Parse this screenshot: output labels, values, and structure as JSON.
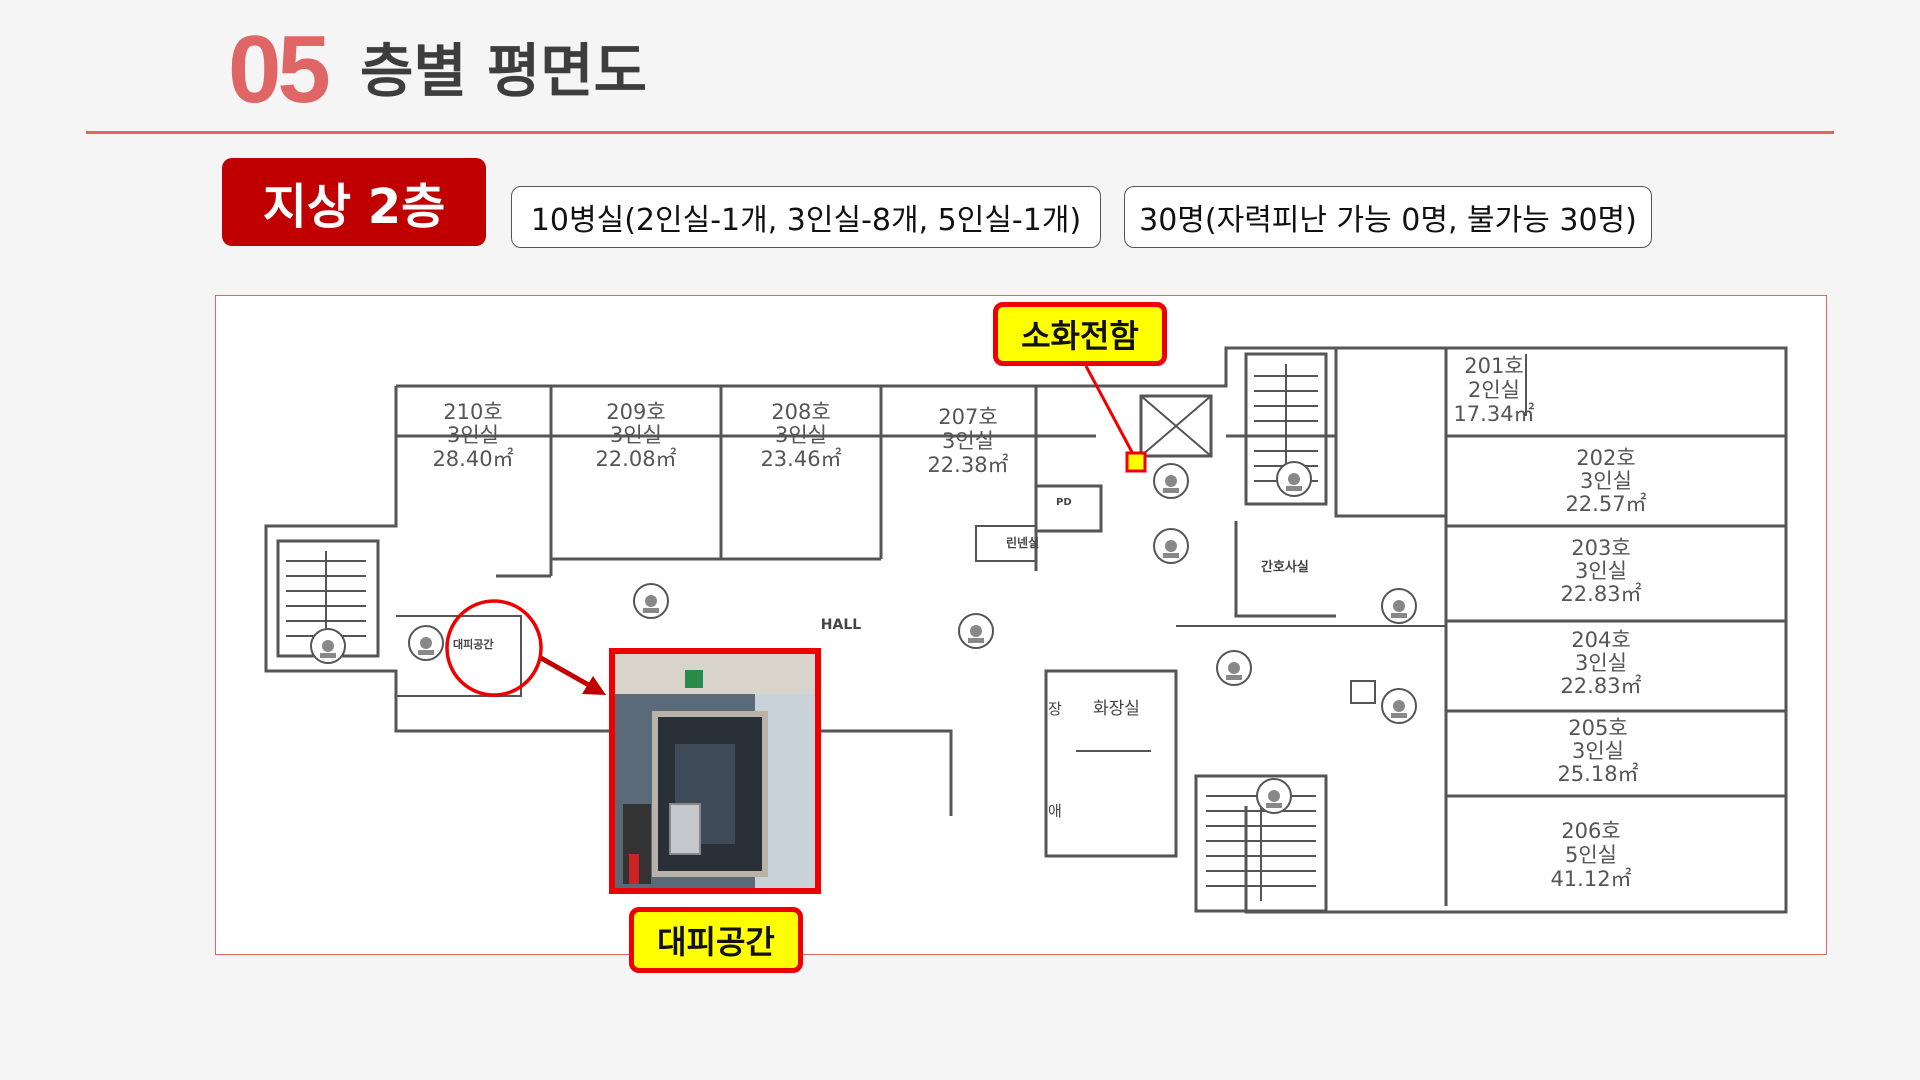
{
  "header": {
    "number": "05",
    "title": "층별 평면도"
  },
  "floor_badge": "지상 2층",
  "info": {
    "rooms_summary": "10병실(2인실-1개, 3인실-8개, 5인실-1개)",
    "people_summary": "30명(자력피난 가능 0명, 불가능 30명)"
  },
  "plan": {
    "rooms": [
      {
        "no": "210호",
        "type": "3인실",
        "area": "28.40㎡"
      },
      {
        "no": "209호",
        "type": "3인실",
        "area": "22.08㎡"
      },
      {
        "no": "208호",
        "type": "3인실",
        "area": "23.46㎡"
      },
      {
        "no": "207호",
        "type": "3인실",
        "area": "22.38㎡"
      },
      {
        "no": "201호",
        "type": "2인실",
        "area": "17.34㎡"
      },
      {
        "no": "202호",
        "type": "3인실",
        "area": "22.57㎡"
      },
      {
        "no": "203호",
        "type": "3인실",
        "area": "22.83㎡"
      },
      {
        "no": "204호",
        "type": "3인실",
        "area": "22.83㎡"
      },
      {
        "no": "205호",
        "type": "3인실",
        "area": "25.18㎡"
      },
      {
        "no": "206호",
        "type": "5인실",
        "area": "41.12㎡"
      }
    ],
    "labels": {
      "hall": "HALL",
      "ev": "EV",
      "pd": "PD",
      "nurse_station": "간호사실",
      "restroom": "화장실",
      "linen": "린넨실",
      "refuge_small": "대피공간",
      "jang": "장",
      "ae": "애"
    }
  },
  "callouts": {
    "fire_hydrant": "소화전함",
    "refuge_space": "대피공간"
  },
  "colors": {
    "accent": "#e06666",
    "badge": "#c00000",
    "callout_bg": "#ffff00",
    "callout_border": "#ee0000"
  }
}
